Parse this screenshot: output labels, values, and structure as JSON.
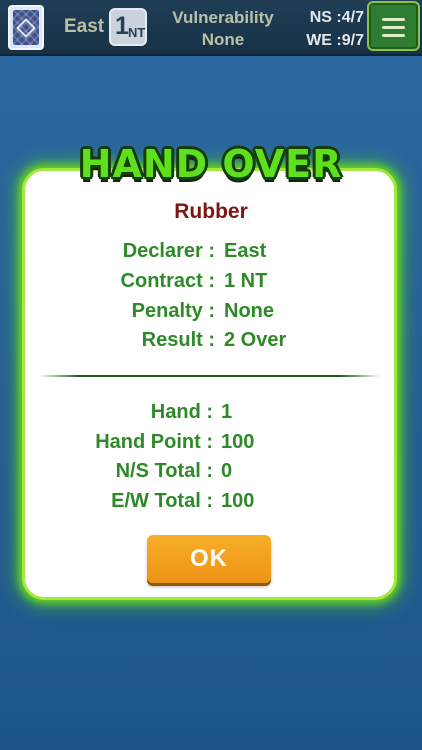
{
  "header": {
    "declarer": "East",
    "contract_level": "1",
    "contract_suit": "NT",
    "vulnerability_label": "Vulnerability",
    "vulnerability_value": "None",
    "ns_score": "NS :4/7",
    "we_score": "WE :9/7"
  },
  "dialog": {
    "title": "HAND OVER",
    "hand_type": "Rubber",
    "details": [
      {
        "label": "Declarer :",
        "value": "East"
      },
      {
        "label": "Contract :",
        "value": "1 NT"
      },
      {
        "label": "Penalty :",
        "value": "None"
      },
      {
        "label": "Result :",
        "value": "2 Over"
      }
    ],
    "totals": [
      {
        "label": "Hand :",
        "value": "1"
      },
      {
        "label": "Hand Point :",
        "value": "100"
      },
      {
        "label": "N/S Total :",
        "value": "0"
      },
      {
        "label": "E/W Total :",
        "value": "100"
      }
    ],
    "ok_label": "OK"
  },
  "colors": {
    "title_green": "#5fe01c",
    "detail_green": "#2e8a28",
    "hand_type_red": "#7d1515",
    "ok_orange": "#f3a021",
    "background_blue": "#2466a0"
  },
  "icons": {
    "card_back": "card-back-icon",
    "menu": "hamburger-menu-icon"
  }
}
